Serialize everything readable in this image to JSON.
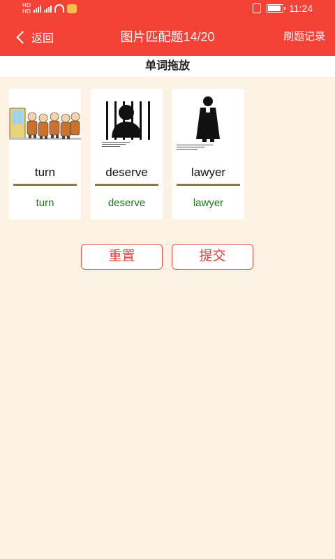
{
  "status": {
    "network_1": "HD",
    "network_2": "HD",
    "time": "11:24"
  },
  "header": {
    "back_label": "返回",
    "title": "图片匹配题14/20",
    "record_label": "刷题记录"
  },
  "subtitle": "单词拖放",
  "cards": [
    {
      "word": "turn",
      "answer": "turn",
      "icon": "people-queue-image"
    },
    {
      "word": "deserve",
      "answer": "deserve",
      "icon": "prisoner-behind-bars-image"
    },
    {
      "word": "lawyer",
      "answer": "lawyer",
      "icon": "lawyer-silhouette-image"
    }
  ],
  "buttons": {
    "reset": "重置",
    "submit": "提交"
  },
  "colors": {
    "brand": "#f44336",
    "background": "#fcf3e4",
    "answer": "#1b7a1b"
  }
}
